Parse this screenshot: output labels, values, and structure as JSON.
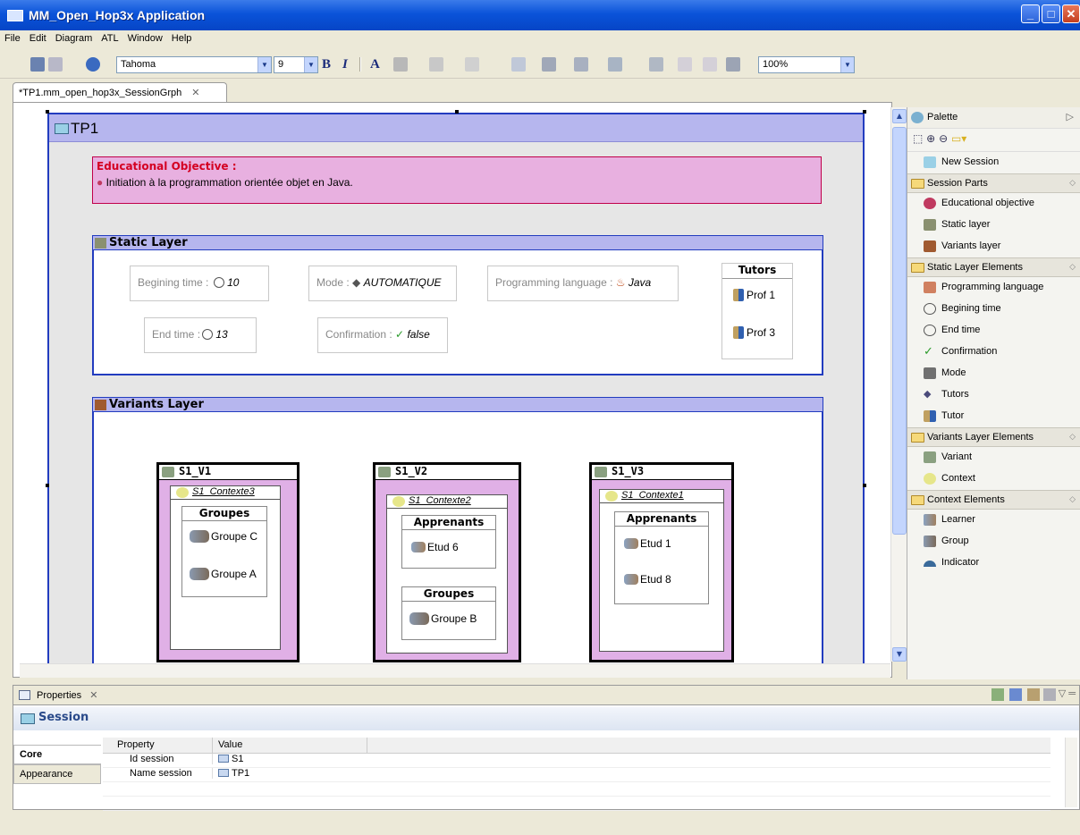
{
  "window": {
    "title": "MM_Open_Hop3x Application"
  },
  "menu": [
    "File",
    "Edit",
    "Diagram",
    "ATL",
    "Window",
    "Help"
  ],
  "toolbar": {
    "font_name": "Tahoma",
    "font_size": "9",
    "bold": "B",
    "italic": "I",
    "font_color": "A",
    "zoom": "100%"
  },
  "editor_tab": {
    "label": "*TP1.mm_open_hop3x_SessionGrph",
    "close": "✕"
  },
  "session": {
    "name": "TP1"
  },
  "objective": {
    "title": "Educational Objective :",
    "text": "Initiation à la programmation orientée objet en Java."
  },
  "static_layer": {
    "title": "Static Layer",
    "begin_label": "Begining time :",
    "begin_value": "10",
    "end_label": "End time :",
    "end_value": "13",
    "mode_label": "Mode :",
    "mode_value": "AUTOMATIQUE",
    "confirm_label": "Confirmation :",
    "confirm_value": "false",
    "lang_label": "Programming language :",
    "lang_value": "Java",
    "tutors_title": "Tutors",
    "tutors": [
      "Prof 1",
      "Prof 3"
    ]
  },
  "variants_layer": {
    "title": "Variants Layer",
    "variants": [
      {
        "name": "S1_V1",
        "context": "S1_Contexte3",
        "groups_title": "Groupes",
        "groups": [
          "Groupe C",
          "Groupe A"
        ]
      },
      {
        "name": "S1_V2",
        "context": "S1_Contexte2",
        "learners_title": "Apprenants",
        "learners": [
          "Etud 6"
        ],
        "groups_title": "Groupes",
        "groups": [
          "Groupe B"
        ]
      },
      {
        "name": "S1_V3",
        "context": "S1_Contexte1",
        "learners_title": "Apprenants",
        "learners": [
          "Etud 1",
          "Etud 8"
        ]
      }
    ]
  },
  "palette": {
    "title": "Palette",
    "new_session": "New Session",
    "drawers": [
      {
        "label": "Session Parts",
        "items": [
          "Educational objective",
          "Static layer",
          "Variants layer"
        ]
      },
      {
        "label": "Static Layer Elements",
        "items": [
          "Programming language",
          "Begining time",
          "End time",
          "Confirmation",
          "Mode",
          "Tutors",
          "Tutor"
        ]
      },
      {
        "label": "Variants Layer Elements",
        "items": [
          "Variant",
          "Context"
        ]
      },
      {
        "label": "Context Elements",
        "items": [
          "Learner",
          "Group",
          "Indicator"
        ]
      }
    ]
  },
  "properties": {
    "tab_label": "Properties",
    "close": "✕",
    "title": "Session",
    "tabs": [
      "Core",
      "Appearance"
    ],
    "headers": [
      "Property",
      "Value"
    ],
    "rows": [
      {
        "property": "Id session",
        "value": "S1"
      },
      {
        "property": "Name session",
        "value": "TP1"
      }
    ]
  }
}
